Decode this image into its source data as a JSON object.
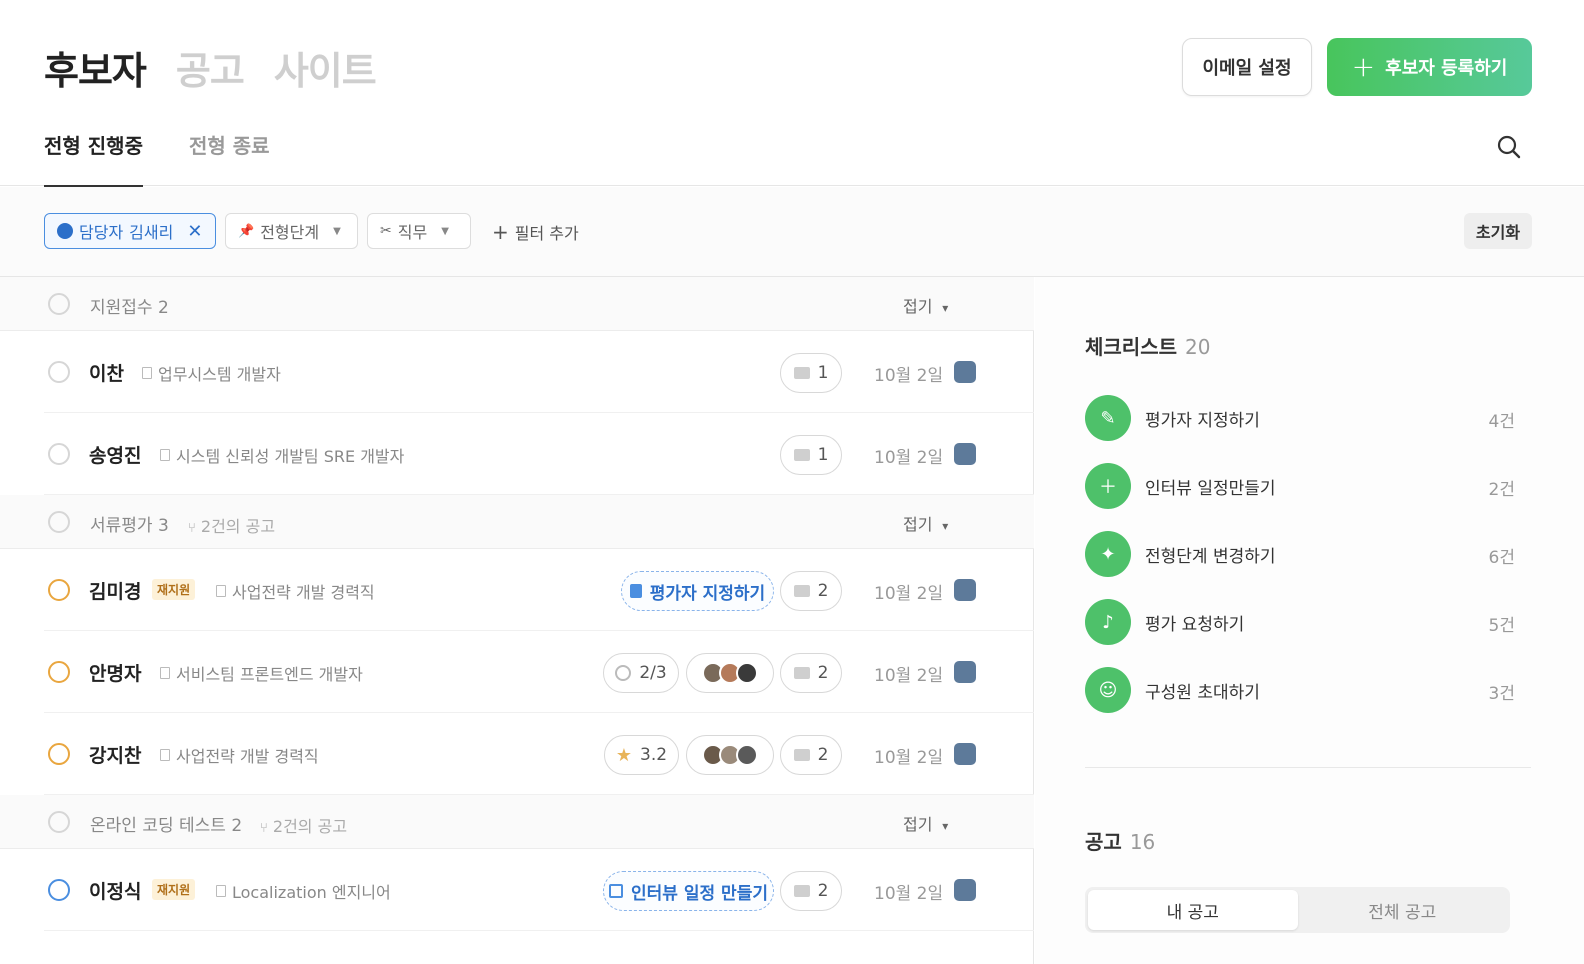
{
  "header": {
    "tabs": [
      "후보자",
      "공고",
      "사이트"
    ],
    "email_settings": "이메일 설정",
    "add_candidate": "후보자 등록하기",
    "sub_tabs": [
      "전형 진행중",
      "전형 종료"
    ]
  },
  "filters": {
    "chip1_label": "담당자",
    "chip1_value": "김새리",
    "chip2": "전형단계",
    "chip3": "직무",
    "add_filter": "필터 추가",
    "reset": "초기화"
  },
  "groups": [
    {
      "title": "지원접수 2",
      "sub": "",
      "collapse": "접기"
    },
    {
      "title": "서류평가 3",
      "sub": "2건의 공고",
      "collapse": "접기"
    },
    {
      "title": "온라인 코딩 테스트 2",
      "sub": "2건의 공고",
      "collapse": "접기"
    }
  ],
  "rows": [
    {
      "name": "이찬",
      "job": "업무시스템 개발자",
      "mail": "1",
      "date": "10월 2일"
    },
    {
      "name": "송영진",
      "job": "시스템 신뢰성 개발팀 SRE 개발자",
      "mail": "1",
      "date": "10월 2일"
    },
    {
      "name": "김미경",
      "tag": "재지원",
      "job": "사업전략 개발 경력직",
      "action": "평가자 지정하기",
      "mail": "2",
      "date": "10월 2일"
    },
    {
      "name": "안명자",
      "job": "서비스팀 프론트엔드 개발자",
      "progress": "2/3",
      "mail": "2",
      "date": "10월 2일"
    },
    {
      "name": "강지찬",
      "job": "사업전략 개발 경력직",
      "score": "3.2",
      "mail": "2",
      "date": "10월 2일"
    },
    {
      "name": "이정식",
      "tag": "재지원",
      "job": "Localization 엔지니어",
      "action": "인터뷰 일정 만들기",
      "mail": "2",
      "date": "10월 2일"
    }
  ],
  "checklist": {
    "title": "체크리스트",
    "count": "20",
    "items": [
      {
        "label": "평가자 지정하기",
        "count": "4건"
      },
      {
        "label": "인터뷰 일정만들기",
        "count": "2건"
      },
      {
        "label": "전형단계 변경하기",
        "count": "6건"
      },
      {
        "label": "평가 요청하기",
        "count": "5건"
      },
      {
        "label": "구성원 초대하기",
        "count": "3건"
      }
    ]
  },
  "postings": {
    "title": "공고",
    "count": "16",
    "seg": [
      "내 공고",
      "전체 공고"
    ]
  }
}
